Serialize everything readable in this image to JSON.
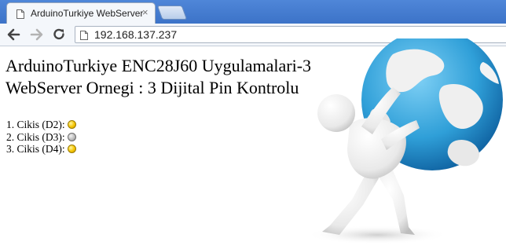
{
  "browser": {
    "tab_title": "ArduinoTurkiye WebServer",
    "tab_close": "×",
    "url": "192.168.137.237"
  },
  "page": {
    "heading_line1": "ArduinoTurkiye ENC28J60 Uygulamalari-3",
    "heading_line2": "WebServer Ornegi : 3  Dijital Pin  Kontrolu",
    "pins": [
      {
        "label": "1. Cikis (D2):",
        "state": "on",
        "color": "#f5c400"
      },
      {
        "label": "2. Cikis (D3):",
        "state": "off",
        "color": "#bdbdbd"
      },
      {
        "label": "3. Cikis (D4):",
        "state": "on",
        "color": "#f5c400"
      }
    ],
    "illustration": "person-carrying-globe"
  },
  "colors": {
    "tabstrip": "#3c73c8",
    "globe_ocean": "#2f9fd8"
  }
}
